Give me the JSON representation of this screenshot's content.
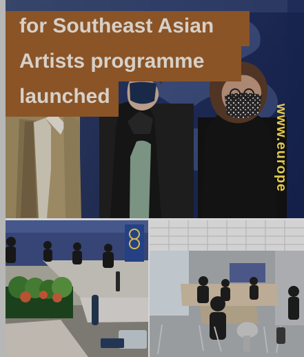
{
  "headline": {
    "line1": "for Southeast Asian",
    "line2": "Artists programme",
    "line3": "launched"
  },
  "backdrop": {
    "url": "www.europe"
  },
  "colors": {
    "headline_bg": "#8a5427",
    "headline_text": "#d7d0c8",
    "url": "#e1c84f"
  }
}
